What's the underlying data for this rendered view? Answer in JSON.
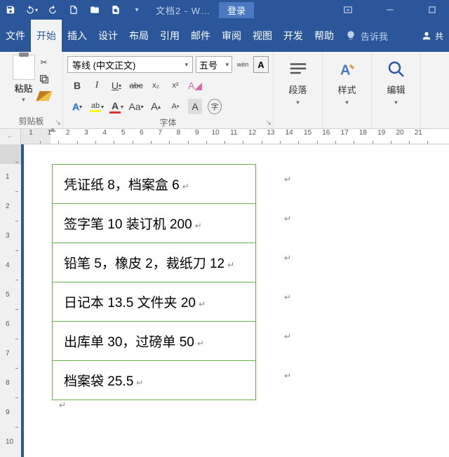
{
  "titlebar": {
    "doc_title": "文档2  -  W…",
    "login": "登录"
  },
  "menus": {
    "file": "文件",
    "home": "开始",
    "insert": "插入",
    "design": "设计",
    "layout": "布局",
    "references": "引用",
    "mailings": "邮件",
    "review": "审阅",
    "view": "视图",
    "developer": "开发",
    "help": "帮助",
    "tellme": "告诉我",
    "share": "共"
  },
  "ribbon": {
    "clipboard": {
      "paste": "粘贴",
      "label": "剪贴板"
    },
    "font": {
      "name": "等线 (中文正文)",
      "size": "五号",
      "pinyin": "wén",
      "charborder": "A",
      "bold": "B",
      "italic": "I",
      "underline": "U",
      "strike": "abc",
      "sub": "x₂",
      "sup": "x²",
      "textfx": "A",
      "highlight": "ab",
      "fontcolor": "A",
      "case": "Aa",
      "grow": "A",
      "shrink": "A",
      "charshade": "A",
      "label": "字体"
    },
    "paragraph": {
      "label": "段落"
    },
    "styles": {
      "label": "样式"
    },
    "editing": {
      "label": "编辑"
    }
  },
  "ruler_h": [
    1,
    1,
    2,
    3,
    4,
    5,
    6,
    7,
    8,
    9,
    10,
    11,
    12,
    13,
    14,
    15,
    16,
    17,
    18,
    19,
    20,
    21
  ],
  "ruler_v": [
    1,
    2,
    3,
    4,
    5,
    6,
    7,
    8,
    9,
    10
  ],
  "table_rows": [
    "凭证纸 8，档案盒 6",
    "签字笔 10 装订机 200",
    "铅笔 5，橡皮 2，裁纸刀 12",
    "日记本 13.5 文件夹 20",
    "出库单 30，过磅单 50",
    "档案袋 25.5"
  ]
}
